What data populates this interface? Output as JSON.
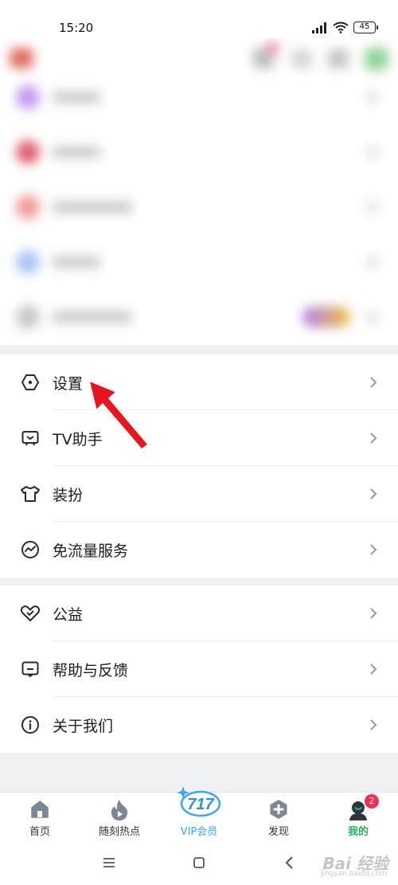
{
  "status_bar": {
    "time": "15:20",
    "battery": "45"
  },
  "menu_group_1": [
    {
      "label": "设置",
      "icon": "settings-hex-icon"
    },
    {
      "label": "TV助手",
      "icon": "tv-icon"
    },
    {
      "label": "装扮",
      "icon": "shirt-icon"
    },
    {
      "label": "免流量服务",
      "icon": "traffic-wave-icon"
    }
  ],
  "menu_group_2": [
    {
      "label": "公益",
      "icon": "heart-icon"
    },
    {
      "label": "帮助与反馈",
      "icon": "feedback-icon"
    },
    {
      "label": "关于我们",
      "icon": "info-icon"
    }
  ],
  "bottom_nav": [
    {
      "label": "首页",
      "icon": "home-icon",
      "active": false
    },
    {
      "label": "随刻热点",
      "icon": "flame-play-icon",
      "active": false
    },
    {
      "label": "VIP会员",
      "icon": "vip-717-icon",
      "active": false
    },
    {
      "label": "发现",
      "icon": "discover-plus-icon",
      "active": false
    },
    {
      "label": "我的",
      "icon": "profile-icon",
      "active": true,
      "badge": "2"
    }
  ],
  "colors": {
    "accent_green": "#1fb85a",
    "vip_blue": "#3aa7f0",
    "badge_red": "#ee2e57",
    "arrow_red": "#e8141e"
  },
  "watermark": {
    "text": "Bai 经验",
    "sub": "jingyan.baidu.com"
  }
}
